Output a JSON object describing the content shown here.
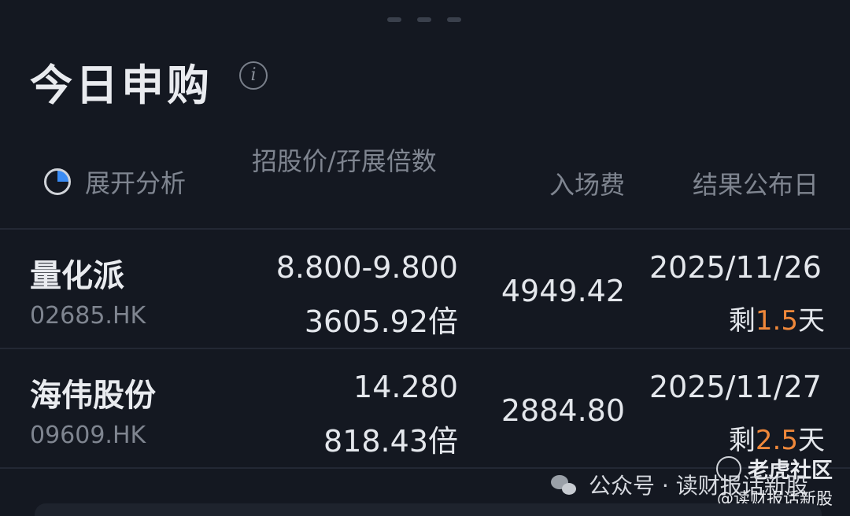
{
  "panel": {
    "title": "今日申购"
  },
  "header": {
    "expand_label": "展开分析",
    "price_col": "招股价/孖展倍数",
    "fee_col": "入场费",
    "date_col": "结果公布日"
  },
  "rows": [
    {
      "name": "量化派",
      "code": "02685.HK",
      "price": "8.800-9.800",
      "multiple": "3605.92倍",
      "fee": "4949.42",
      "date": "2025/11/26",
      "remain_prefix": "剩",
      "remain_days": "1.5",
      "remain_suffix": "天"
    },
    {
      "name": "海伟股份",
      "code": "09609.HK",
      "price": "14.280",
      "multiple": "818.43倍",
      "fee": "2884.80",
      "date": "2025/11/27",
      "remain_prefix": "剩",
      "remain_days": "2.5",
      "remain_suffix": "天"
    }
  ],
  "watermarks": {
    "tiger": "老虎社区",
    "wechat": "公众号 · 读财报话新股",
    "handle": "@读财报话新股"
  },
  "colors": {
    "background": "#141821",
    "accent_orange": "#f0883a",
    "pie_blue": "#3b8cf3"
  },
  "icons": [
    "info-icon",
    "pie-chart-icon",
    "tiger-icon",
    "wechat-icon"
  ]
}
